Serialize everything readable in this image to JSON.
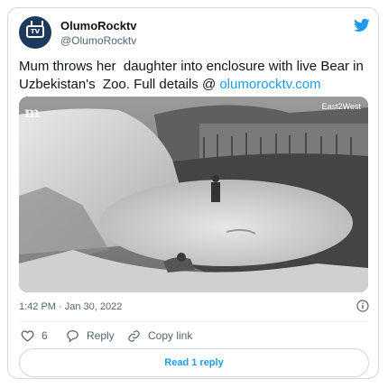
{
  "author": {
    "name": "OlumoRocktv",
    "handle": "@OlumoRocktv",
    "avatar_text": "TV"
  },
  "tweet": {
    "text": "Mum throws her  daughter into enclosure with live Bear in Uzbekistan's  Zoo. Full details @ ",
    "link": "olumorocktv.com",
    "media": {
      "watermark_left": "m",
      "watermark_right": "East2West"
    },
    "timestamp": "1:42 PM · Jan 30, 2022"
  },
  "actions": {
    "like_count": "6",
    "reply_label": "Reply",
    "copy_link_label": "Copy link",
    "read_replies_label": "Read 1 reply"
  },
  "colors": {
    "accent": "#1d9bf0",
    "text": "#0f1419",
    "muted": "#536471",
    "border": "#cfd9de"
  }
}
